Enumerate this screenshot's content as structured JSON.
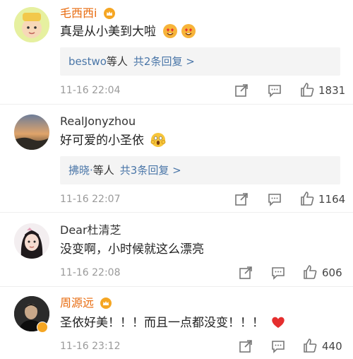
{
  "comments": [
    {
      "name": "毛西西i",
      "text": "真是从小美到大啦",
      "reply": {
        "who": "bestwo",
        "rest": "等人",
        "count": "共2条回复 >"
      },
      "time": "11-16 22:04",
      "likes": "1831"
    },
    {
      "name": "RealJonyzhou",
      "text": "好可爱的小圣依",
      "reply": {
        "who": "拂晓·",
        "rest": "等人",
        "count": "共3条回复 >"
      },
      "time": "11-16 22:07",
      "likes": "1164"
    },
    {
      "name": "Dear杜清芝",
      "text": "没变啊，小时候就这么漂亮",
      "time": "11-16 22:08",
      "likes": "606"
    },
    {
      "name": "周源远",
      "text": "圣依好美！！！而且一点都没变！！！",
      "time": "11-16 23:12",
      "likes": "440"
    }
  ],
  "colors": {
    "vip_name": "#e86b0f",
    "link": "#4a76a8",
    "meta": "#9a9a9a"
  }
}
